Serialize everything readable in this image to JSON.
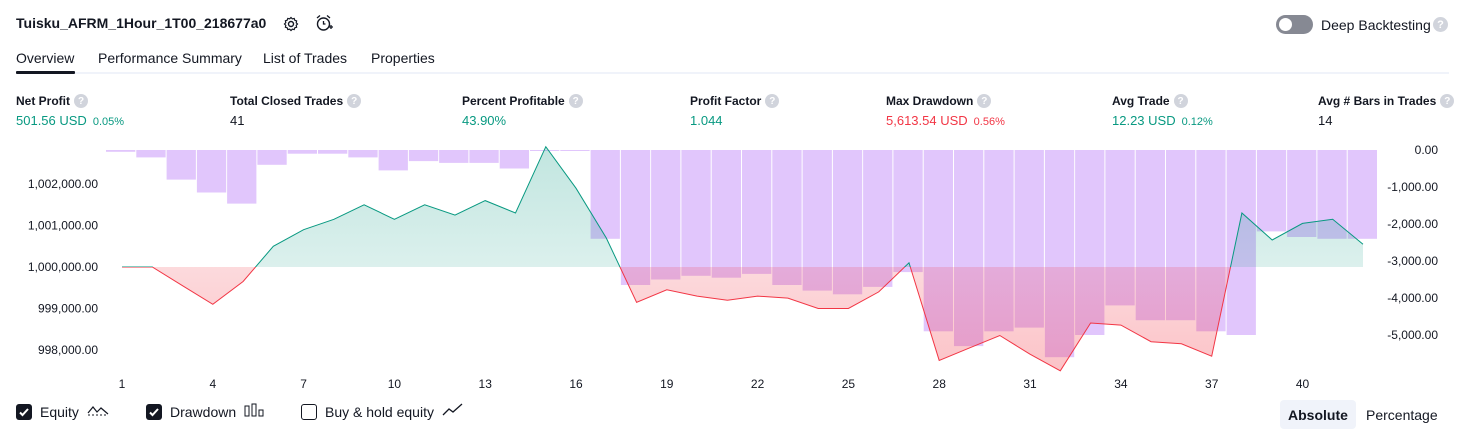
{
  "header": {
    "title": "Tuisku_AFRM_1Hour_1T00_218677a0",
    "settings_icon": "gear-icon",
    "alert_icon": "alarm-add-icon",
    "deep_backtesting_label": "Deep Backtesting",
    "deep_backtesting_enabled": false,
    "help_glyph": "?"
  },
  "tabs": [
    {
      "label": "Overview",
      "active": true
    },
    {
      "label": "Performance Summary",
      "active": false
    },
    {
      "label": "List of Trades",
      "active": false
    },
    {
      "label": "Properties",
      "active": false
    }
  ],
  "stats": {
    "net_profit": {
      "label": "Net Profit",
      "value": "501.56 USD",
      "pct": "0.05%"
    },
    "total_closed_trades": {
      "label": "Total Closed Trades",
      "value": "41"
    },
    "percent_profitable": {
      "label": "Percent Profitable",
      "value": "43.90%"
    },
    "profit_factor": {
      "label": "Profit Factor",
      "value": "1.044"
    },
    "max_drawdown": {
      "label": "Max Drawdown",
      "value": "5,613.54 USD",
      "pct": "0.56%"
    },
    "avg_trade": {
      "label": "Avg Trade",
      "value": "12.23 USD",
      "pct": "0.12%"
    },
    "avg_bars": {
      "label": "Avg # Bars in Trades",
      "value": "14"
    }
  },
  "chart_data": {
    "type": "area",
    "baseline": 1000000,
    "x_ticks": [
      "1",
      "4",
      "7",
      "10",
      "13",
      "16",
      "19",
      "22",
      "25",
      "28",
      "31",
      "34",
      "37",
      "40"
    ],
    "left_axis": {
      "ticks": [
        "1,002,000.00",
        "1,001,000.00",
        "1,000,000.00",
        "999,000.00",
        "998,000.00"
      ],
      "ylim": [
        997600,
        1002800
      ]
    },
    "right_axis": {
      "ticks": [
        "0.00",
        "-1,000.00",
        "-2,000.00",
        "-3,000.00",
        "-4,000.00",
        "-5,000.00"
      ],
      "ylim": [
        -5900,
        0
      ]
    },
    "series": [
      {
        "name": "Equity",
        "x": [
          1,
          2,
          3,
          4,
          5,
          6,
          7,
          8,
          9,
          10,
          11,
          12,
          13,
          14,
          15,
          16,
          17,
          18,
          19,
          20,
          21,
          22,
          23,
          24,
          25,
          26,
          27,
          28,
          29,
          30,
          31,
          32,
          33,
          34,
          35,
          36,
          37,
          38,
          39,
          40,
          41,
          42
        ],
        "values": [
          1000000,
          1000000,
          999550,
          999100,
          999650,
          1000500,
          1000900,
          1001150,
          1001500,
          1001150,
          1001500,
          1001250,
          1001600,
          1001300,
          1002900,
          1001900,
          1000700,
          999150,
          999450,
          999300,
          999200,
          999300,
          999250,
          999000,
          999000,
          999400,
          1000100,
          997750,
          998050,
          998350,
          997900,
          997500,
          998650,
          998600,
          998200,
          998150,
          997850,
          1001300,
          1000650,
          1001050,
          1001150,
          1000550
        ],
        "color": "#089981"
      },
      {
        "name": "Drawdown",
        "values": [
          -50,
          -200,
          -800,
          -1150,
          -1450,
          -400,
          -100,
          -100,
          -200,
          -550,
          -300,
          -350,
          -350,
          -500,
          0,
          0,
          -2400,
          -3650,
          -3500,
          -3400,
          -3450,
          -3350,
          -3650,
          -3800,
          -3900,
          -3700,
          -3300,
          -4900,
          -5300,
          -4900,
          -4800,
          -5600,
          -5000,
          -4200,
          -4600,
          -4600,
          -4900,
          -5000,
          -2200,
          -2350,
          -2400,
          -2400
        ],
        "color": "#ce93d8"
      }
    ],
    "equity_color_pos": "#089981",
    "equity_color_neg": "#f23645",
    "drawdown_color": "#dcbcfb"
  },
  "legend": {
    "equity": {
      "label": "Equity",
      "checked": true
    },
    "drawdown": {
      "label": "Drawdown",
      "checked": true
    },
    "buy_hold": {
      "label": "Buy & hold equity",
      "checked": false
    }
  },
  "scale_toggle": {
    "absolute": "Absolute",
    "percentage": "Percentage",
    "selected": "absolute"
  }
}
